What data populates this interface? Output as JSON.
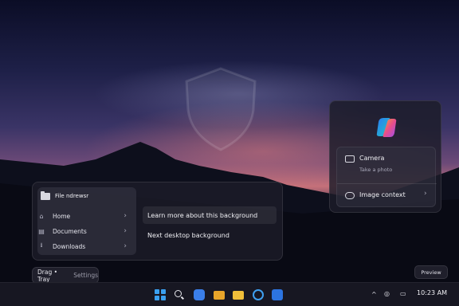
{
  "file_panel": {
    "title": "File ndrewsr",
    "nav": [
      {
        "label": "Home",
        "icon": "home-icon"
      },
      {
        "label": "Documents",
        "icon": "documents-icon"
      },
      {
        "label": "Downloads",
        "icon": "download-icon"
      }
    ],
    "menu": {
      "learn_more": "Learn more about this background",
      "next_background": "Next desktop background"
    }
  },
  "drag_tray": {
    "label": "Drag • Tray",
    "settings": "Settings"
  },
  "copilot": {
    "camera_title": "Camera",
    "camera_sub": "Take a photo",
    "image_context": "Image context"
  },
  "preview_button": "Preview",
  "taskbar": {
    "apps": [
      "start-icon",
      "search-icon",
      "copilot-app-icon",
      "file-explorer-icon",
      "folder-icon",
      "edge-icon",
      "store-icon"
    ],
    "clock": "10:23 AM"
  },
  "colors": {
    "accent": "#3aa0f0"
  }
}
